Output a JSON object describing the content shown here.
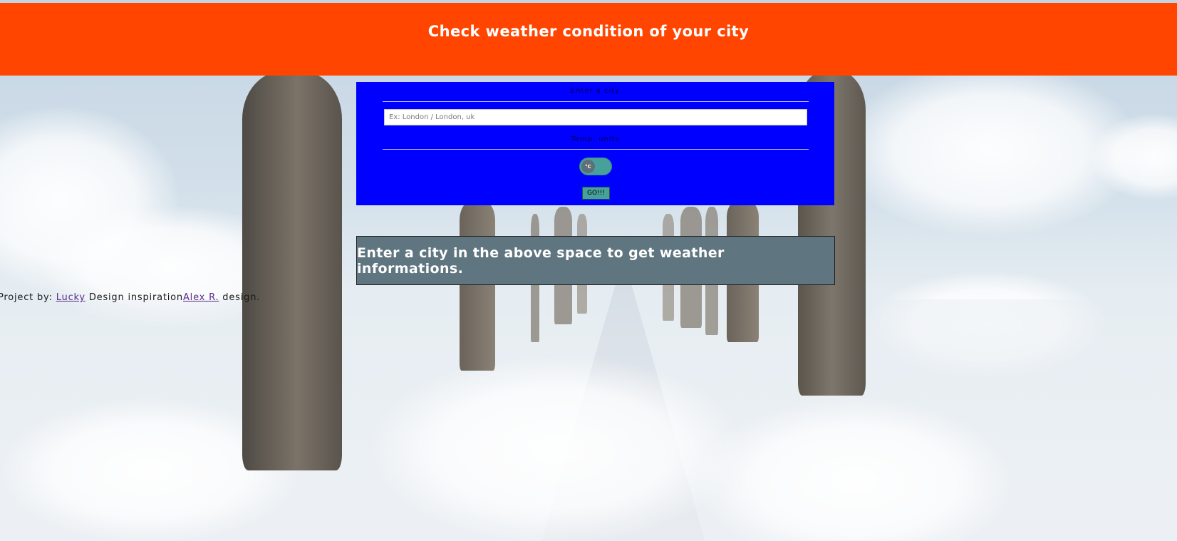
{
  "header": {
    "title": "Check weather condition of your city"
  },
  "form": {
    "city_label": "Enter a city",
    "city_input_placeholder": "Ex: London / London, uk",
    "city_input_value": "",
    "temp_label": "Temp. units",
    "toggle_unit": "°C",
    "go_label": "GO!!!"
  },
  "info": {
    "message": "Enter a city in the above space to get weather informations."
  },
  "credits": {
    "prefix": "Project by: ",
    "author_link": "Lucky",
    "middle": " Design inspiration",
    "inspiration_link": "Alex R.",
    "suffix": " design."
  },
  "colors": {
    "header_bg": "#ff4500",
    "panel_bg": "#0000ff",
    "toggle_bg": "#48a09a",
    "info_bg": "#5f7580"
  }
}
